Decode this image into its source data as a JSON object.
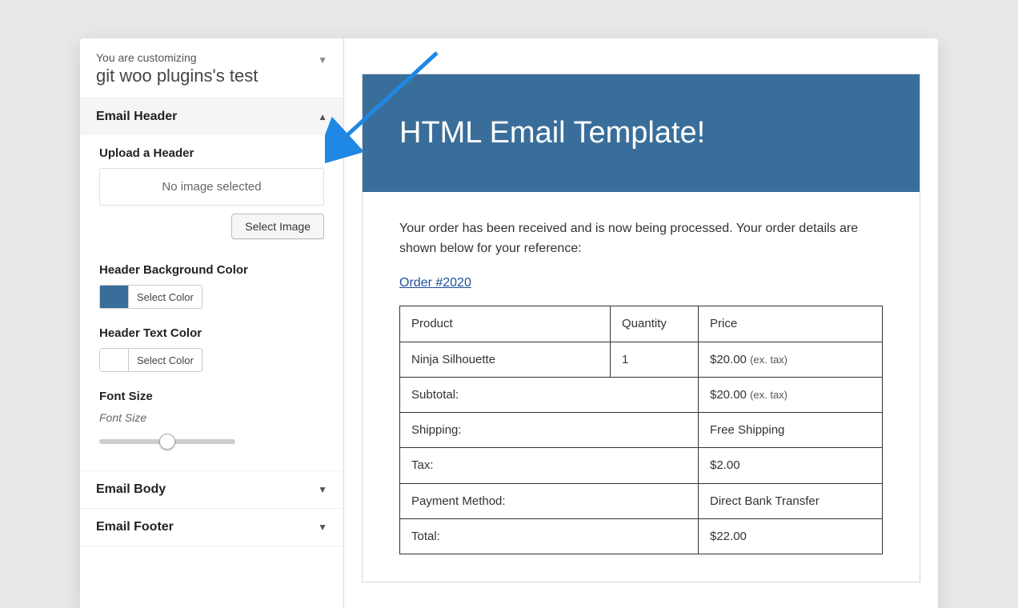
{
  "sidebar": {
    "customizing_label": "You are customizing",
    "site_title": "git woo plugins's test",
    "sections": {
      "header": {
        "title": "Email Header",
        "upload_label": "Upload a Header",
        "no_image": "No image selected",
        "select_image_btn": "Select Image",
        "bg_label": "Header Background Color",
        "txt_label": "Header Text Color",
        "select_color": "Select Color",
        "font_size_label": "Font Size",
        "font_size_sub": "Font Size"
      },
      "body": {
        "title": "Email Body"
      },
      "footer": {
        "title": "Email Footer"
      }
    }
  },
  "preview": {
    "hero": "HTML Email Template!",
    "intro": "Your order has been received and is now being processed. Your order details are shown below for your reference:",
    "order_link": "Order #2020",
    "table": {
      "headers": {
        "product": "Product",
        "qty": "Quantity",
        "price": "Price"
      },
      "item": {
        "name": "Ninja Silhouette",
        "qty": "1",
        "price": "$20.00",
        "price_note": "(ex. tax)"
      },
      "rows": {
        "subtotal": {
          "label": "Subtotal:",
          "value": "$20.00",
          "note": "(ex. tax)"
        },
        "shipping": {
          "label": "Shipping:",
          "value": "Free Shipping"
        },
        "tax": {
          "label": "Tax:",
          "value": "$2.00"
        },
        "payment": {
          "label": "Payment Method:",
          "value": "Direct Bank Transfer"
        },
        "total": {
          "label": "Total:",
          "value": "$22.00"
        }
      }
    }
  },
  "colors": {
    "header_bg": "#3a6e9a"
  }
}
